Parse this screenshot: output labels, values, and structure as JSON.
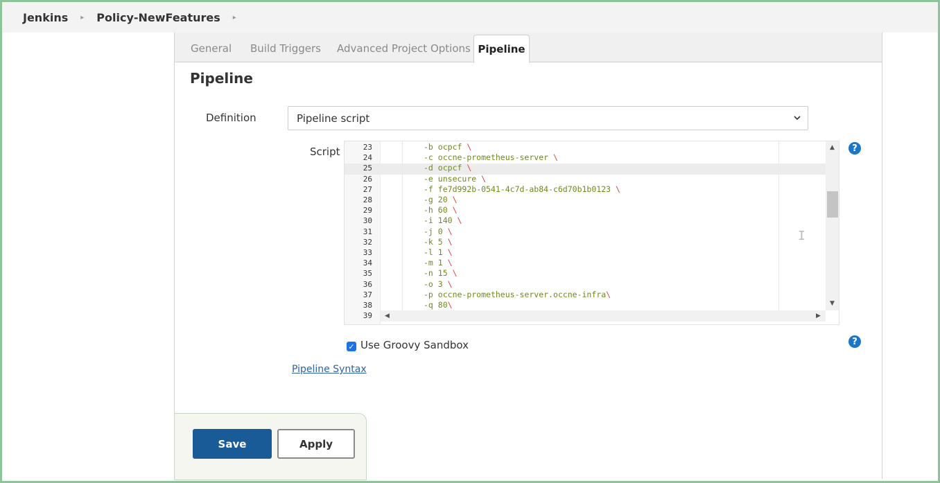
{
  "breadcrumb": {
    "items": [
      "Jenkins",
      "Policy-NewFeatures"
    ]
  },
  "tabs": [
    "General",
    "Build Triggers",
    "Advanced Project Options",
    "Pipeline"
  ],
  "active_tab": "Pipeline",
  "section_title": "Pipeline",
  "definition": {
    "label": "Definition",
    "selected": "Pipeline script"
  },
  "script": {
    "label": "Script",
    "lines": [
      {
        "num": "23",
        "opt": "-b",
        "val": "ocpcf",
        "bs": " \\"
      },
      {
        "num": "24",
        "opt": "-c",
        "val": "occne-prometheus-server",
        "bs": " \\"
      },
      {
        "num": "25",
        "opt": "-d",
        "val": "ocpcf",
        "bs": " \\"
      },
      {
        "num": "26",
        "opt": "-e",
        "val": "unsecure",
        "bs": " \\"
      },
      {
        "num": "27",
        "opt": "-f",
        "val": "fe7d992b-0541-4c7d-ab84-c6d70b1b0123",
        "bs": " \\"
      },
      {
        "num": "28",
        "opt": "-g",
        "val": "20",
        "bs": " \\"
      },
      {
        "num": "29",
        "opt": "-h",
        "val": "60",
        "bs": " \\"
      },
      {
        "num": "30",
        "opt": "-i",
        "val": "140",
        "bs": " \\"
      },
      {
        "num": "31",
        "opt": "-j",
        "val": "0",
        "bs": " \\"
      },
      {
        "num": "32",
        "opt": "-k",
        "val": "5",
        "bs": " \\"
      },
      {
        "num": "33",
        "opt": "-l",
        "val": "1",
        "bs": " \\"
      },
      {
        "num": "34",
        "opt": "-m",
        "val": "1",
        "bs": " \\"
      },
      {
        "num": "35",
        "opt": "-n",
        "val": "15",
        "bs": " \\"
      },
      {
        "num": "36",
        "opt": "-o",
        "val": "3",
        "bs": " \\"
      },
      {
        "num": "37",
        "opt": "-p",
        "val": "occne-prometheus-server.occne-infra",
        "bs": "\\"
      },
      {
        "num": "38",
        "opt": "-q",
        "val": "80",
        "bs": "\\"
      },
      {
        "num": "39",
        "opt": "",
        "val": "",
        "bs": ""
      }
    ],
    "active_line": "25"
  },
  "sandbox": {
    "label": "Use Groovy Sandbox",
    "checked": true
  },
  "pipeline_syntax_link": "Pipeline Syntax",
  "buttons": {
    "save": "Save",
    "apply": "Apply"
  },
  "colors": {
    "accent": "#1b76c8",
    "save_bg": "#185b96",
    "frame": "#8fc49b"
  }
}
